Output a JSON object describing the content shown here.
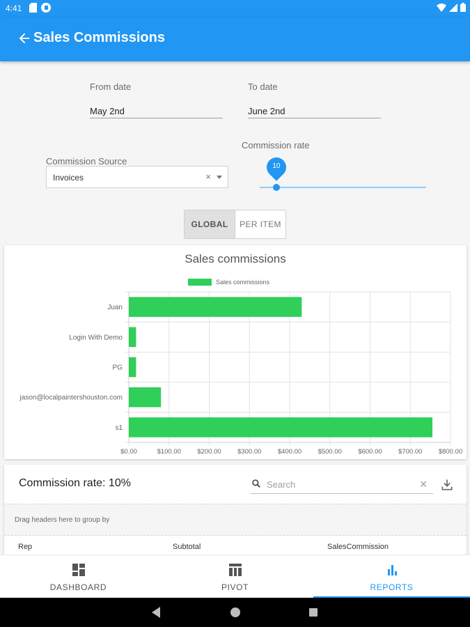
{
  "status_bar": {
    "time": "4:41"
  },
  "app_bar": {
    "title": "Sales Commissions"
  },
  "filters": {
    "from_date": {
      "label": "From date",
      "value": "May 2nd"
    },
    "to_date": {
      "label": "To date",
      "value": "June 2nd"
    },
    "commission_source": {
      "label": "Commission Source",
      "value": "Invoices",
      "clear_glyph": "×"
    },
    "commission_rate": {
      "label": "Commission rate",
      "value": 10,
      "min": 0,
      "max": 100
    }
  },
  "toggle": {
    "options": [
      "GLOBAL",
      "PER ITEM"
    ],
    "selected": "GLOBAL"
  },
  "chart_data": {
    "type": "bar",
    "orientation": "horizontal",
    "title": "Sales commissions",
    "legend": {
      "placement": "top",
      "entries": [
        "Sales commissions"
      ]
    },
    "categories": [
      "Juan",
      "Login With Demo",
      "PG",
      "jason@localpaintershouston.com",
      "s1"
    ],
    "series": [
      {
        "name": "Sales commissions",
        "values": [
          430,
          18,
          18,
          80,
          755
        ],
        "color": "#2fcf5a"
      }
    ],
    "xlim": [
      0,
      800
    ],
    "x_ticks": [
      "$0.00",
      "$100.00",
      "$200.00",
      "$300.00",
      "$400.00",
      "$500.00",
      "$600.00",
      "$700.00",
      "$800.00"
    ],
    "grid": true
  },
  "table": {
    "title": "Commission rate: 10%",
    "search_placeholder": "Search",
    "group_panel_text": "Drag headers here to group by",
    "columns": [
      "Rep",
      "Subtotal",
      "SalesCommission"
    ]
  },
  "bottom_nav": {
    "items": [
      {
        "label": "DASHBOARD",
        "icon": "dashboard-icon"
      },
      {
        "label": "PIVOT",
        "icon": "pivot-table-icon"
      },
      {
        "label": "REPORTS",
        "icon": "bar-chart-icon"
      }
    ],
    "active": "REPORTS"
  },
  "colors": {
    "primary": "#2196f3",
    "bar": "#2fcf5a"
  }
}
